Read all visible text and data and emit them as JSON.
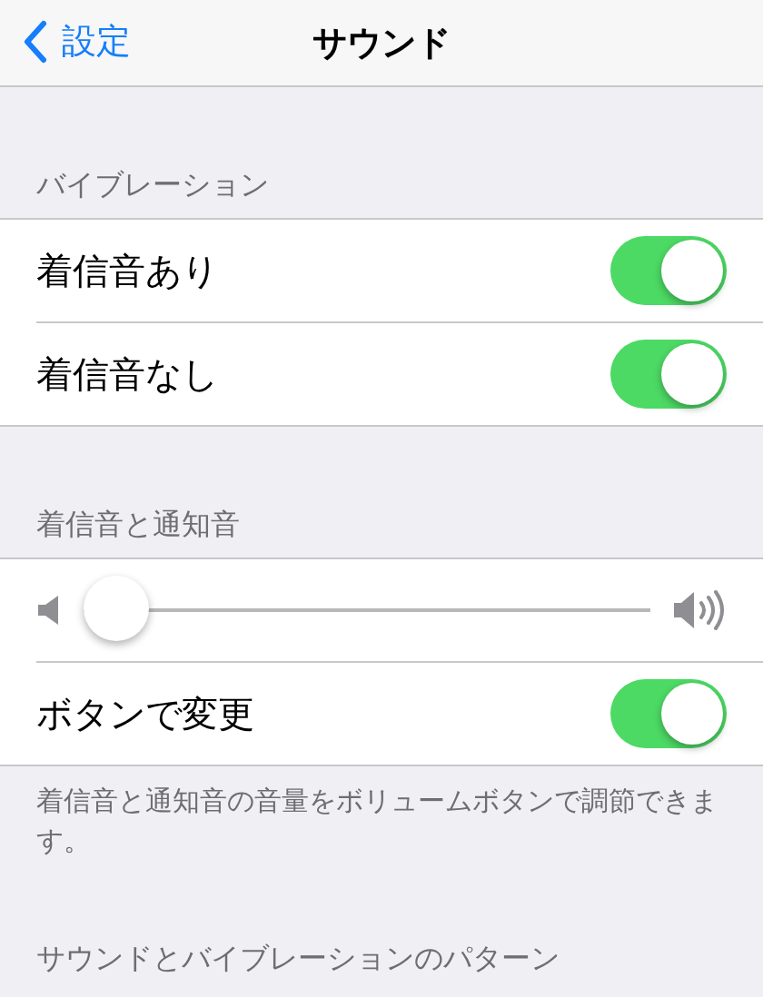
{
  "nav": {
    "back": "設定",
    "title": "サウンド"
  },
  "sections": [
    {
      "header": "バイブレーション",
      "rows": [
        {
          "kind": "switch",
          "label": "着信音あり",
          "on": true
        },
        {
          "kind": "switch",
          "label": "着信音なし",
          "on": true
        }
      ]
    },
    {
      "header": "着信音と通知音",
      "rows": [
        {
          "kind": "slider",
          "level": 0
        },
        {
          "kind": "switch",
          "label": "ボタンで変更",
          "on": true
        }
      ],
      "footer": "着信音と通知音の音量をボリュームボタンで調節できます。"
    },
    {
      "header": "サウンドとバイブレーションのパターン"
    }
  ]
}
